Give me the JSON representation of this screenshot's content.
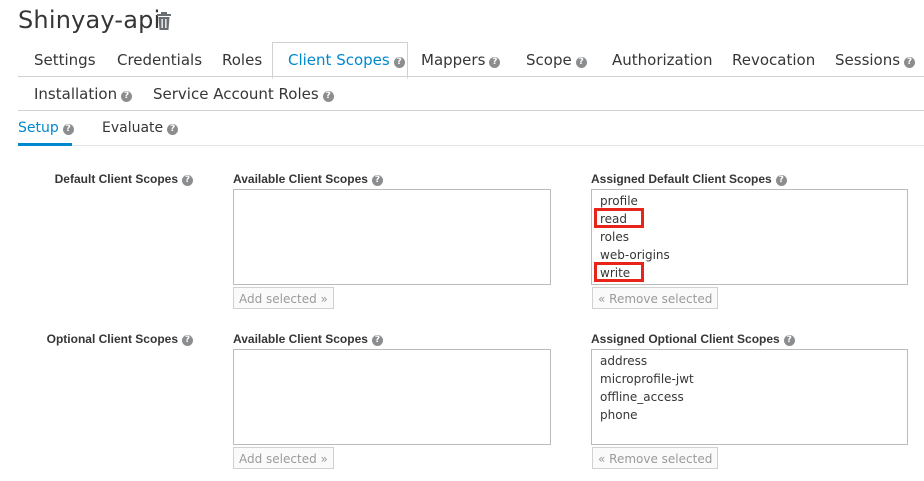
{
  "page": {
    "title": "Shinyay-api"
  },
  "icons": {
    "delete": "trash-icon",
    "help": "question-circle-icon"
  },
  "colors": {
    "accent": "#0088ce",
    "highlight": "#e8231a",
    "text": "#363636"
  },
  "tabs": [
    {
      "label": "Settings"
    },
    {
      "label": "Credentials"
    },
    {
      "label": "Roles"
    },
    {
      "label": "Client Scopes"
    },
    {
      "label": "Mappers"
    },
    {
      "label": "Scope"
    },
    {
      "label": "Authorization"
    },
    {
      "label": "Revocation"
    },
    {
      "label": "Sessions"
    },
    {
      "label": "Installation"
    },
    {
      "label": "Service Account Roles"
    }
  ],
  "active_tab": "Client Scopes",
  "subtabs": [
    {
      "label": "Setup"
    },
    {
      "label": "Evaluate"
    }
  ],
  "active_subtab": "Setup",
  "default_scopes": {
    "label": "Default Client Scopes",
    "available_label": "Available Client Scopes",
    "available": [],
    "assigned_label": "Assigned Default Client Scopes",
    "assigned": [
      "profile",
      "read",
      "roles",
      "web-origins",
      "write"
    ],
    "highlighted": [
      "read",
      "write"
    ],
    "add_button": "Add selected »",
    "remove_button": "« Remove selected"
  },
  "optional_scopes": {
    "label": "Optional Client Scopes",
    "available_label": "Available Client Scopes",
    "available": [],
    "assigned_label": "Assigned Optional Client Scopes",
    "assigned": [
      "address",
      "microprofile-jwt",
      "offline_access",
      "phone"
    ],
    "add_button": "Add selected »",
    "remove_button": "« Remove selected"
  }
}
